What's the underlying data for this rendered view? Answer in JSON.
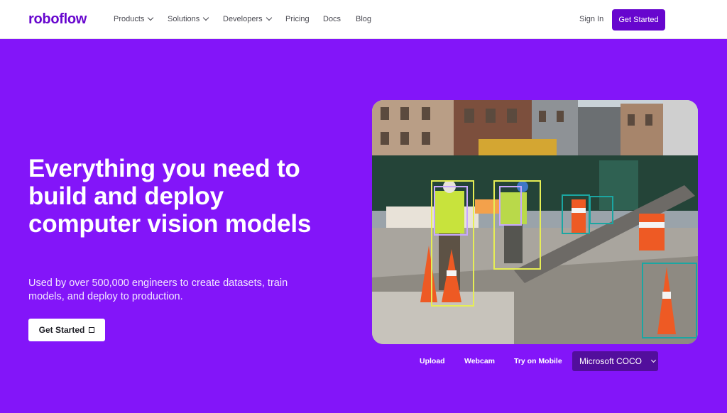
{
  "nav": {
    "logo": "roboflow",
    "items": [
      {
        "label": "Products",
        "dropdown": true
      },
      {
        "label": "Solutions",
        "dropdown": true
      },
      {
        "label": "Developers",
        "dropdown": true
      },
      {
        "label": "Pricing",
        "dropdown": false
      },
      {
        "label": "Docs",
        "dropdown": false
      },
      {
        "label": "Blog",
        "dropdown": false
      }
    ],
    "sign_in": "Sign In",
    "cta": "Get Started"
  },
  "hero": {
    "title": "Everything you need to build and deploy computer vision models",
    "subtitle": "Used by over 500,000 engineers to create datasets, train models, and deploy to production.",
    "cta": "Get Started",
    "cta_icon": "external-link-icon"
  },
  "demo": {
    "controls": {
      "upload": "Upload",
      "webcam": "Webcam",
      "mobile": "Try on Mobile"
    },
    "model": "Microsoft COCO"
  },
  "colors": {
    "brand": "#6706ce",
    "hero_bg": "#8315f9",
    "select_bg": "#520e9c"
  }
}
